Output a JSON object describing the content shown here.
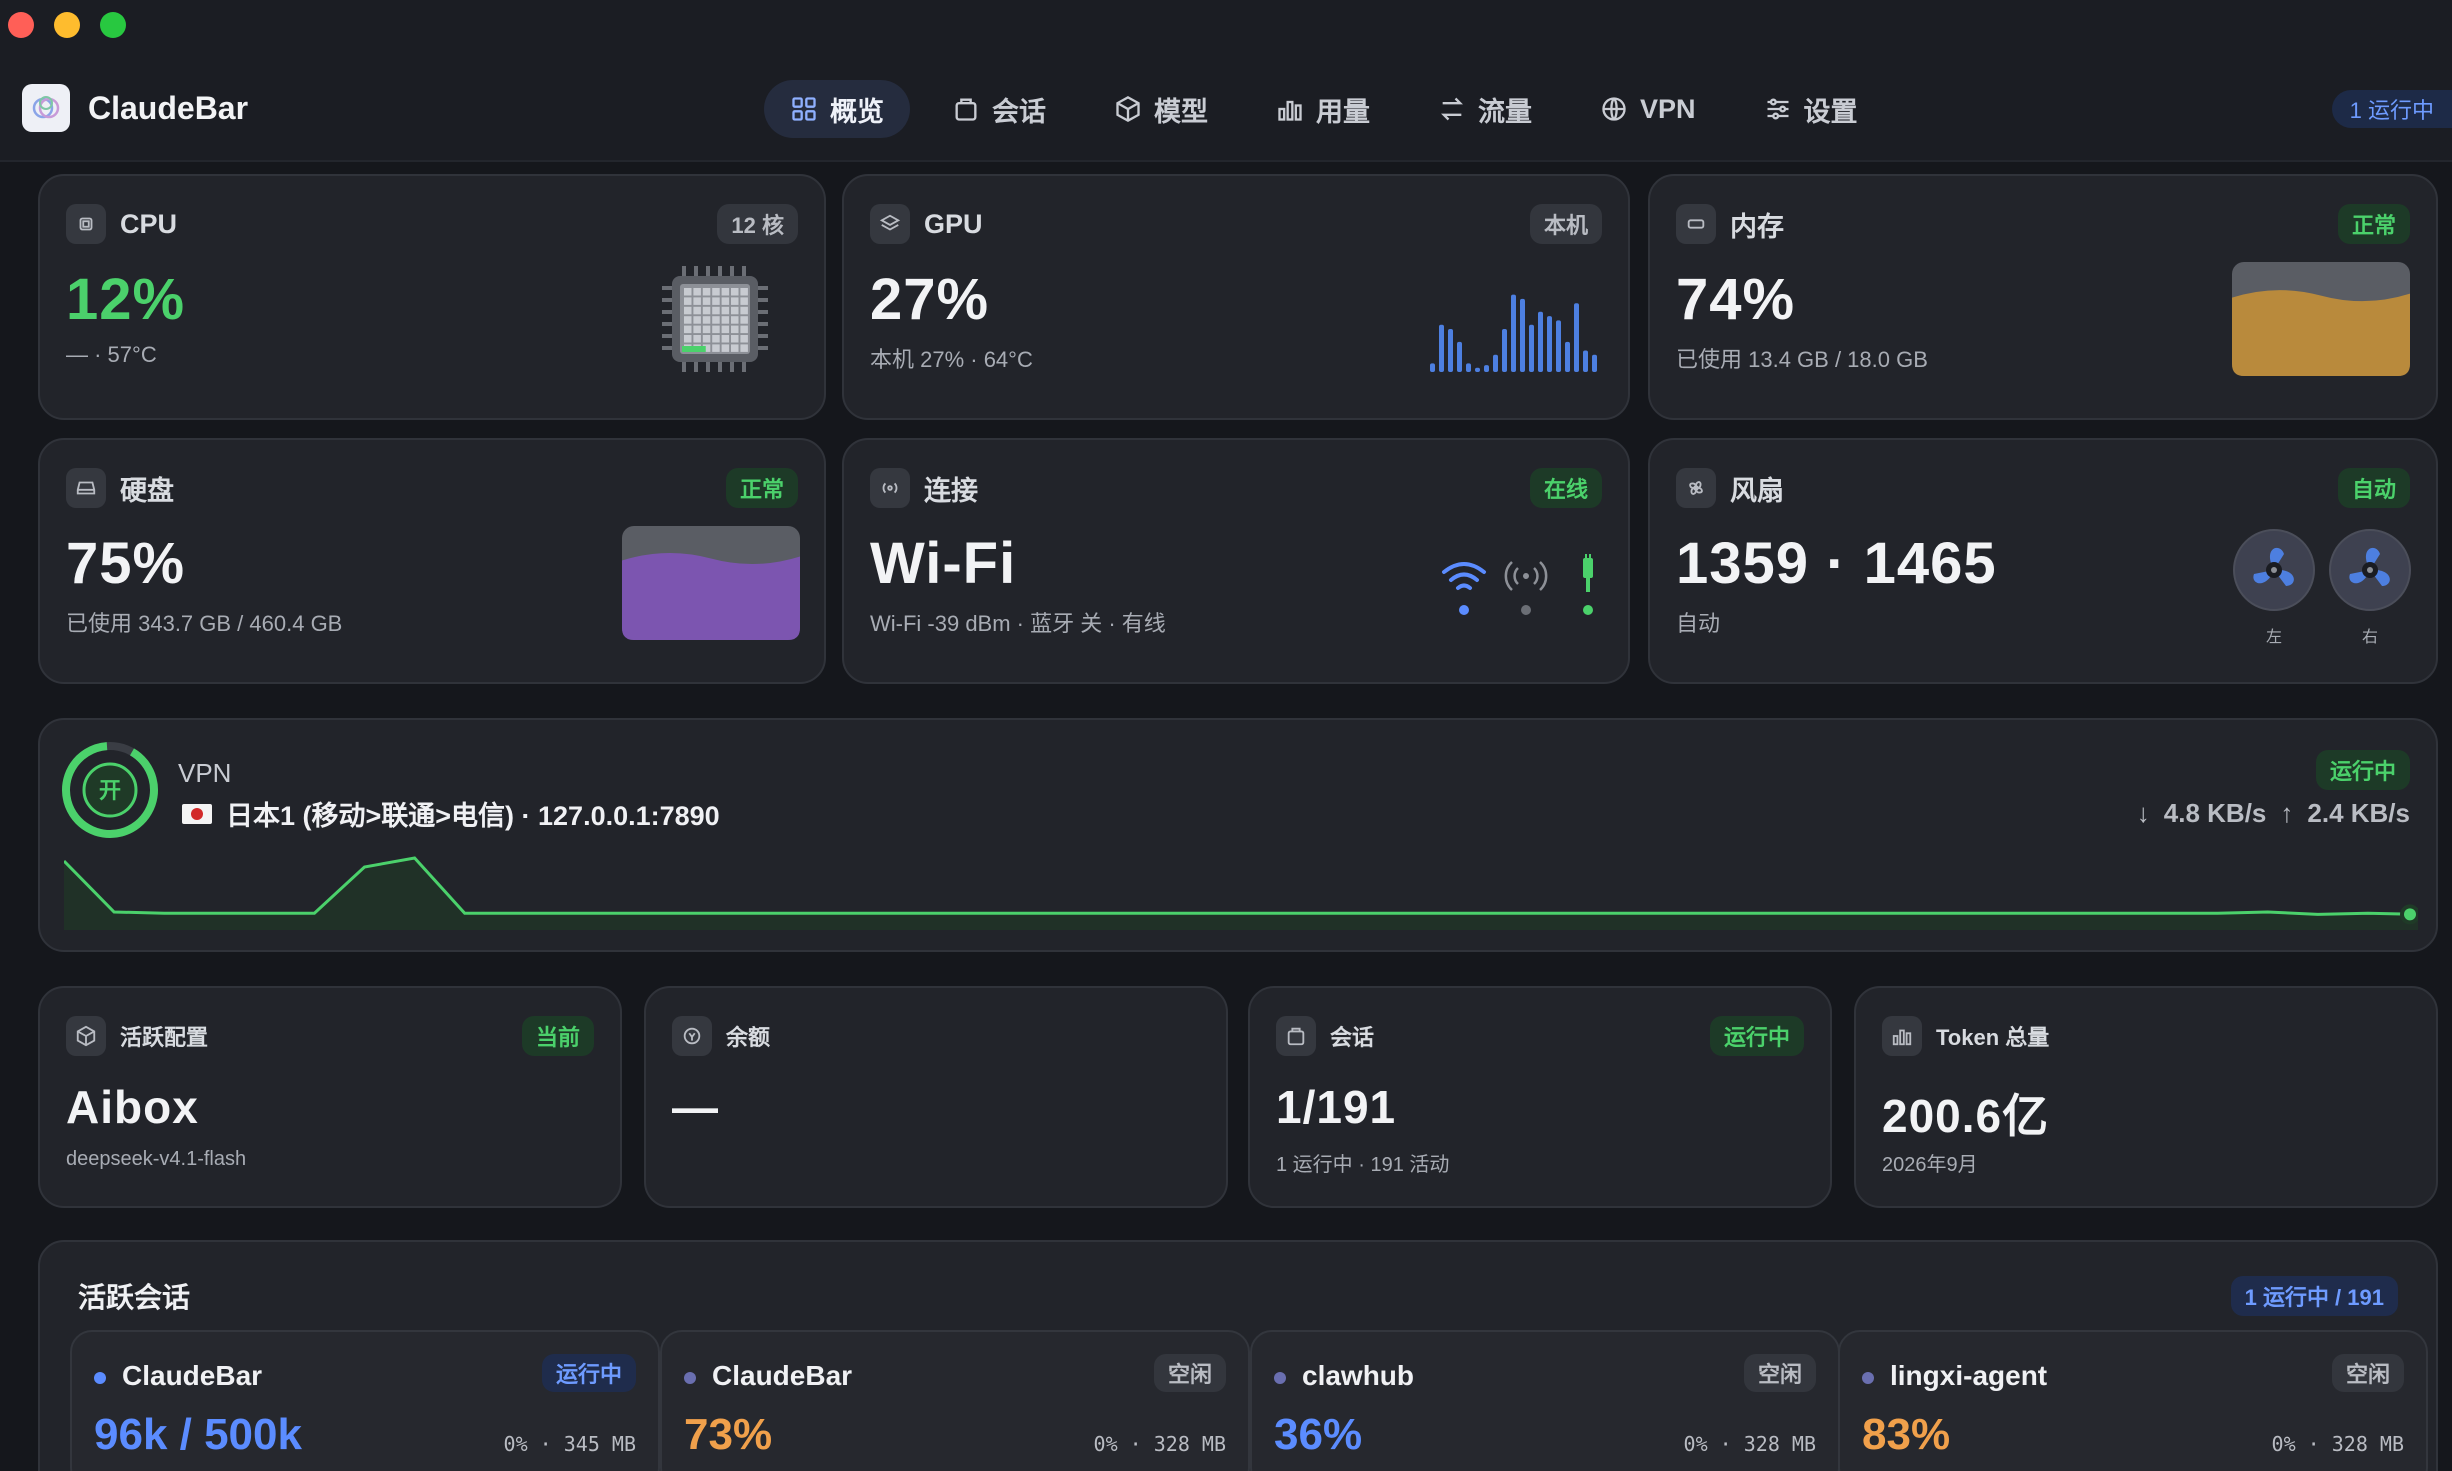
{
  "app": {
    "title": "ClaudeBar",
    "running_pill": "1 运行中"
  },
  "nav": [
    {
      "label": "概览",
      "icon": "grid-icon",
      "active": true
    },
    {
      "label": "会话",
      "icon": "bag-icon"
    },
    {
      "label": "模型",
      "icon": "cube-icon"
    },
    {
      "label": "用量",
      "icon": "bars-icon"
    },
    {
      "label": "流量",
      "icon": "arrows-icon"
    },
    {
      "label": "VPN",
      "icon": "globe-icon"
    },
    {
      "label": "设置",
      "icon": "sliders-icon"
    }
  ],
  "cpu": {
    "title": "CPU",
    "badge": "12 核",
    "value": "12%",
    "sub": "— · 57°C",
    "usage": 0.12
  },
  "gpu": {
    "title": "GPU",
    "badge": "本机",
    "value": "27%",
    "sub": "本机 27% · 64°C",
    "bars": [
      0.1,
      0.55,
      0.5,
      0.35,
      0.1,
      0.05,
      0.08,
      0.2,
      0.5,
      0.9,
      0.85,
      0.55,
      0.7,
      0.65,
      0.6,
      0.35,
      0.8,
      0.25,
      0.2
    ]
  },
  "memory": {
    "title": "内存",
    "badge": "正常",
    "value": "74%",
    "sub": "已使用 13.4 GB / 18.0 GB",
    "usage": 0.74,
    "color": "#b98a3c"
  },
  "disk": {
    "title": "硬盘",
    "badge": "正常",
    "value": "75%",
    "sub": "已使用 343.7 GB / 460.4 GB",
    "usage": 0.75,
    "color": "#7c55b0"
  },
  "network": {
    "title": "连接",
    "badge": "在线",
    "value": "Wi-Fi",
    "sub": "Wi-Fi -39 dBm · 蓝牙 关 · 有线"
  },
  "fan": {
    "title": "风扇",
    "badge": "自动",
    "value": "1359 · 1465",
    "sub": "自动",
    "left_label": "左",
    "right_label": "右"
  },
  "vpn": {
    "title": "VPN",
    "toggle": "开",
    "badge": "运行中",
    "route": "日本1 (移动>联通>电信) · 127.0.0.1:7890",
    "down": "4.8 KB/s",
    "up": "2.4 KB/s",
    "trace": [
      0.95,
      0.1,
      0.08,
      0.08,
      0.08,
      0.08,
      0.85,
      1.0,
      0.08,
      0.08,
      0.08,
      0.08,
      0.08,
      0.08,
      0.08,
      0.08,
      0.08,
      0.08,
      0.08,
      0.08,
      0.08,
      0.08,
      0.08,
      0.08,
      0.08,
      0.08,
      0.08,
      0.08,
      0.08,
      0.08,
      0.08,
      0.08,
      0.08,
      0.08,
      0.08,
      0.08,
      0.08,
      0.08,
      0.08,
      0.08,
      0.08,
      0.08,
      0.08,
      0.08,
      0.1,
      0.06,
      0.08,
      0.06
    ]
  },
  "profile": {
    "title": "活跃配置",
    "badge": "当前",
    "value": "Aibox",
    "sub": "deepseek-v4.1-flash"
  },
  "balance": {
    "title": "余额",
    "value": "—"
  },
  "sessions_card": {
    "title": "会话",
    "badge": "运行中",
    "value": "1/191",
    "sub": "1 运行中 · 191 活动"
  },
  "tokens": {
    "title": "Token 总量",
    "value": "200.6亿",
    "sub": "2026年9月"
  },
  "active_sessions": {
    "title": "活跃会话",
    "badge": "1 运行中 / 191",
    "items": [
      {
        "name": "ClaudeBar",
        "badge": "运行中",
        "value": "96k / 500k",
        "meta": "0% · 345 MB",
        "color": "#5b8cff",
        "dot": "#5b8cff"
      },
      {
        "name": "ClaudeBar",
        "badge": "空闲",
        "value": "73%",
        "meta": "0% · 328 MB",
        "color": "#f0a04b",
        "dot": "#6a6fb0"
      },
      {
        "name": "clawhub",
        "badge": "空闲",
        "value": "36%",
        "meta": "0% · 328 MB",
        "color": "#5b8cff",
        "dot": "#6a6fb0"
      },
      {
        "name": "lingxi-agent",
        "badge": "空闲",
        "value": "83%",
        "meta": "0% · 328 MB",
        "color": "#f0a04b",
        "dot": "#6a6fb0"
      }
    ]
  }
}
